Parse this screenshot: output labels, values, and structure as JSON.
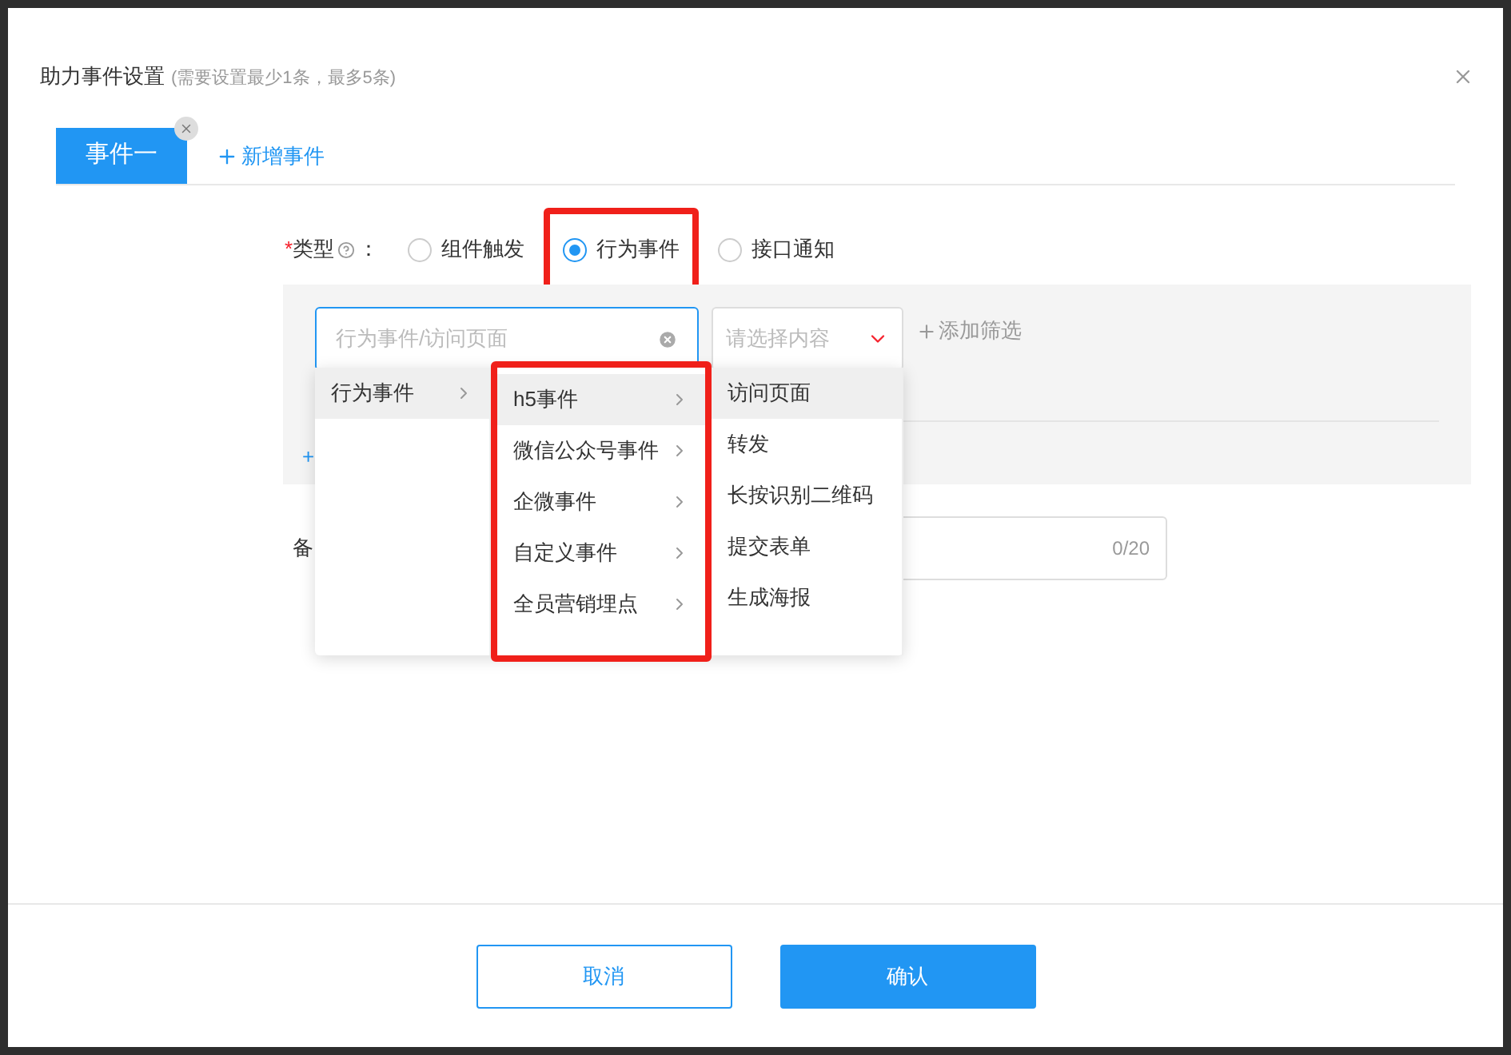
{
  "dialog": {
    "title": "助力事件设置",
    "subtitle": "(需要设置最少1条，最多5条)"
  },
  "tabs": [
    {
      "label": "事件一",
      "selected": true,
      "closable": true
    }
  ],
  "add_tab": "新增事件",
  "type_field": {
    "label": "类型",
    "required_mark": "*",
    "suffix": "：",
    "options": [
      {
        "label": "组件触发",
        "selected": false,
        "highlighted": false
      },
      {
        "label": "行为事件",
        "selected": true,
        "highlighted": true
      },
      {
        "label": "接口通知",
        "selected": false,
        "highlighted": false
      }
    ]
  },
  "event_picker": {
    "placeholder": "行为事件/访问页面",
    "focused": true
  },
  "content_select": {
    "placeholder": "请选择内容"
  },
  "add_filter": "添加筛选",
  "add_row": "+",
  "remark": {
    "label": "备",
    "counter": "0/20"
  },
  "cascader": {
    "columns": [
      {
        "highlighted": false,
        "items": [
          {
            "label": "行为事件",
            "selected": true,
            "has_children": true
          }
        ]
      },
      {
        "highlighted": true,
        "items": [
          {
            "label": "h5事件",
            "selected": true,
            "has_children": true
          },
          {
            "label": "微信公众号事件",
            "selected": false,
            "has_children": true
          },
          {
            "label": "企微事件",
            "selected": false,
            "has_children": true
          },
          {
            "label": "自定义事件",
            "selected": false,
            "has_children": true
          },
          {
            "label": "全员营销埋点",
            "selected": false,
            "has_children": true
          }
        ]
      },
      {
        "highlighted": false,
        "items": [
          {
            "label": "访问页面",
            "selected": true,
            "has_children": false
          },
          {
            "label": "转发",
            "selected": false,
            "has_children": false
          },
          {
            "label": "长按识别二维码",
            "selected": false,
            "has_children": false
          },
          {
            "label": "提交表单",
            "selected": false,
            "has_children": false
          },
          {
            "label": "生成海报",
            "selected": false,
            "has_children": false
          }
        ]
      }
    ]
  },
  "buttons": [
    {
      "label": "取消",
      "kind": "secondary"
    },
    {
      "label": "确认",
      "kind": "primary"
    }
  ]
}
